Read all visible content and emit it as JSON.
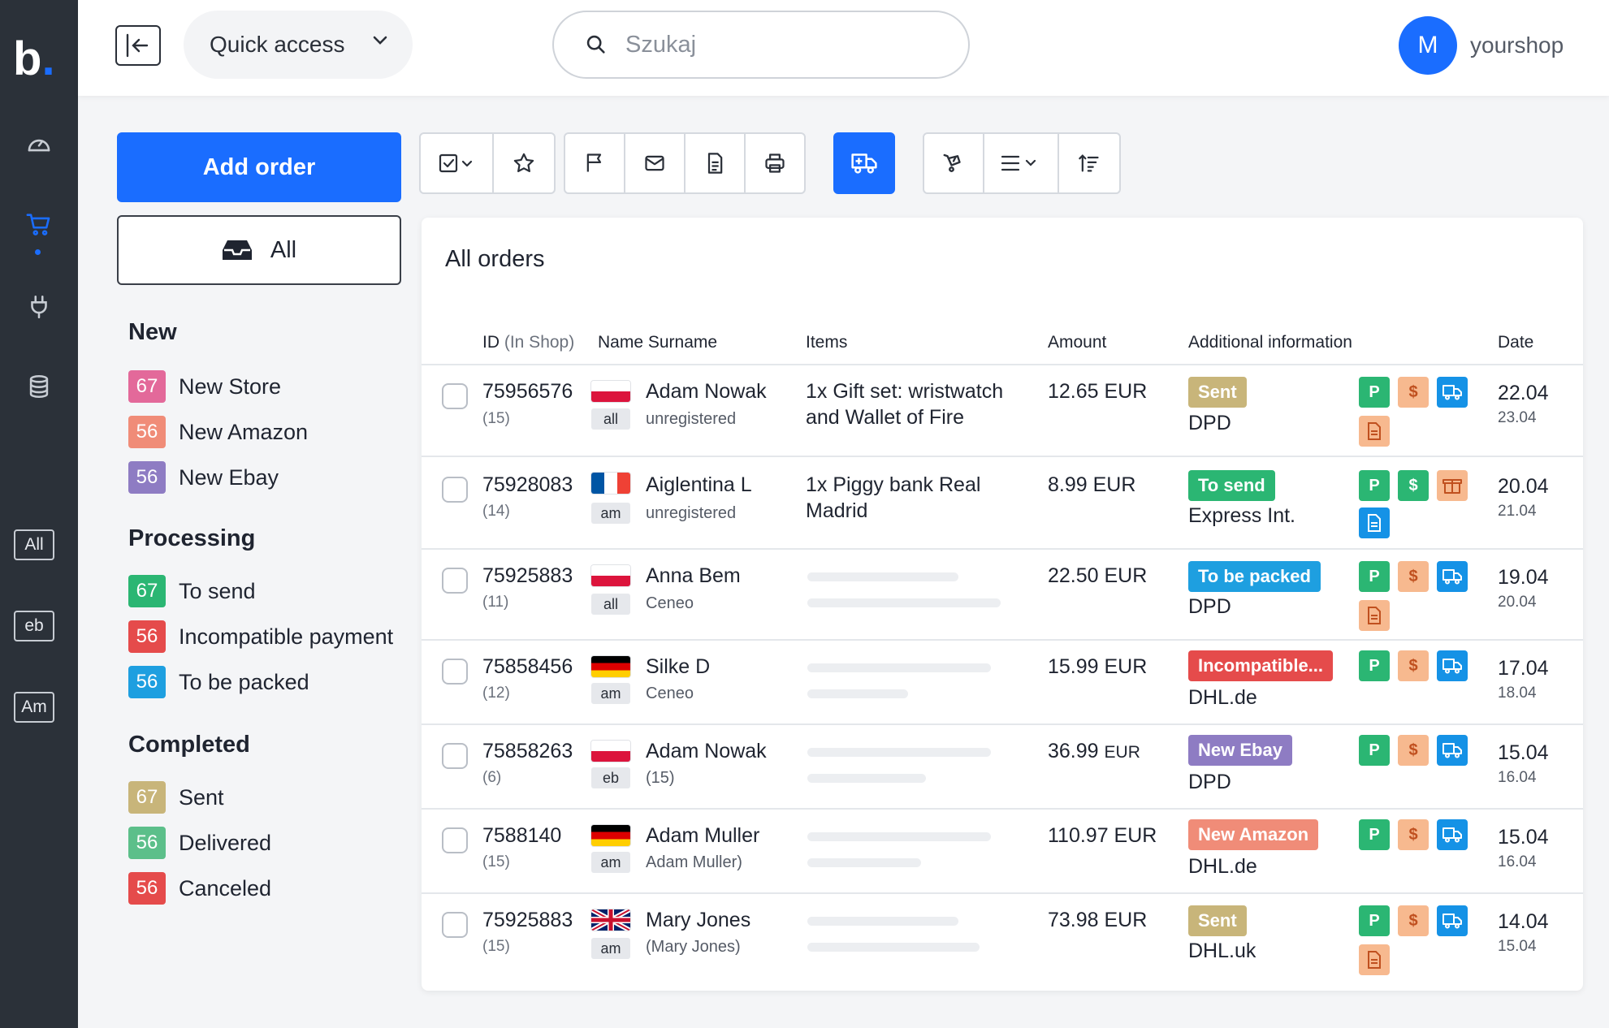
{
  "app": {
    "logo_text": "b",
    "logo_dot": "."
  },
  "rail": {
    "icons": [
      "dashboard-icon",
      "cart-icon",
      "plug-icon",
      "database-icon"
    ],
    "tags": [
      "All",
      "eb",
      "Am"
    ]
  },
  "header": {
    "quick_access_label": "Quick access",
    "search_placeholder": "Szukaj",
    "avatar_letter": "M",
    "shop_name": "yourshop"
  },
  "sidebar": {
    "add_order_label": "Add order",
    "all_label": "All",
    "groups": [
      {
        "title": "New",
        "items": [
          {
            "count": "67",
            "label": "New Store",
            "color": "#e3699a"
          },
          {
            "count": "56",
            "label": "New Amazon",
            "color": "#f08c78"
          },
          {
            "count": "56",
            "label": "New Ebay",
            "color": "#8e7cc3"
          }
        ]
      },
      {
        "title": "Processing",
        "items": [
          {
            "count": "67",
            "label": "To send",
            "color": "#2bb673"
          },
          {
            "count": "56",
            "label": "Incompatible payment",
            "color": "#e54b4b"
          },
          {
            "count": "56",
            "label": "To be packed",
            "color": "#1e9fe0"
          }
        ]
      },
      {
        "title": "Completed",
        "items": [
          {
            "count": "67",
            "label": "Sent",
            "color": "#c8b57a"
          },
          {
            "count": "56",
            "label": "Delivered",
            "color": "#5cbf8a"
          },
          {
            "count": "56",
            "label": "Canceled",
            "color": "#e54b4b"
          }
        ]
      }
    ]
  },
  "orders": {
    "title": "All orders",
    "columns": {
      "id": "ID",
      "id_sub": "(In Shop)",
      "name": "Name Surname",
      "items": "Items",
      "amount": "Amount",
      "info": "Additional information",
      "date": "Date"
    },
    "rows": [
      {
        "id": "75956576",
        "shop_id": "(15)",
        "flag": "pl",
        "channel": "all",
        "name": "Adam Nowak",
        "sub": "unregistered",
        "items": "1x Gift set: wristwatch and Wallet of Fire",
        "amount": "12.65 EUR",
        "status": "Sent",
        "status_color": "#c8b57a",
        "carrier": "DPD",
        "date": "22.04",
        "date2": "23.04"
      },
      {
        "id": "75928083",
        "shop_id": "(14)",
        "flag": "fr",
        "channel": "am",
        "name": "Aiglentina L",
        "sub": "unregistered",
        "items": "1x Piggy bank Real Madrid",
        "amount": "8.99 EUR",
        "status": "To send",
        "status_color": "#2bb673",
        "carrier": "Express Int.",
        "date": "20.04",
        "date2": "21.04"
      },
      {
        "id": "75925883",
        "shop_id": "(11)",
        "flag": "pl",
        "channel": "all",
        "name": "Anna Bem",
        "sub": "Ceneo",
        "items": "",
        "amount": "22.50 EUR",
        "status": "To be packed",
        "status_color": "#1e9fe0",
        "carrier": "DPD",
        "date": "19.04",
        "date2": "20.04"
      },
      {
        "id": "75858456",
        "shop_id": "(12)",
        "flag": "de",
        "channel": "am",
        "name": "Silke D",
        "sub": "Ceneo",
        "items": "",
        "amount": "15.99 EUR",
        "status": "Incompatible...",
        "status_color": "#e54b4b",
        "carrier": "DHL.de",
        "date": "17.04",
        "date2": "18.04"
      },
      {
        "id": "75858263",
        "shop_id": "(6)",
        "flag": "pl",
        "channel": "eb",
        "name": "Adam Nowak",
        "sub": "(15)",
        "items": "",
        "amount_value": "36.99",
        "amount_cur": "EUR",
        "status": "New Ebay",
        "status_color": "#8e7cc3",
        "carrier": "DPD",
        "date": "15.04",
        "date2": "16.04"
      },
      {
        "id": "7588140",
        "shop_id": "(15)",
        "flag": "de",
        "channel": "am",
        "name": "Adam Muller",
        "sub": "Adam Muller)",
        "items": "",
        "amount": "110.97 EUR",
        "status": "New Amazon",
        "status_color": "#f08c78",
        "carrier": "DHL.de",
        "date": "15.04",
        "date2": "16.04"
      },
      {
        "id": "75925883",
        "shop_id": "(15)",
        "flag": "uk",
        "channel": "am",
        "name": "Mary Jones",
        "sub": "(Mary Jones)",
        "items": "",
        "amount": "73.98 EUR",
        "status": "Sent",
        "status_color": "#c8b57a",
        "carrier": "DHL.uk",
        "date": "14.04",
        "date2": "15.04"
      }
    ],
    "icon_letters": {
      "p": "P",
      "d": "$"
    }
  }
}
